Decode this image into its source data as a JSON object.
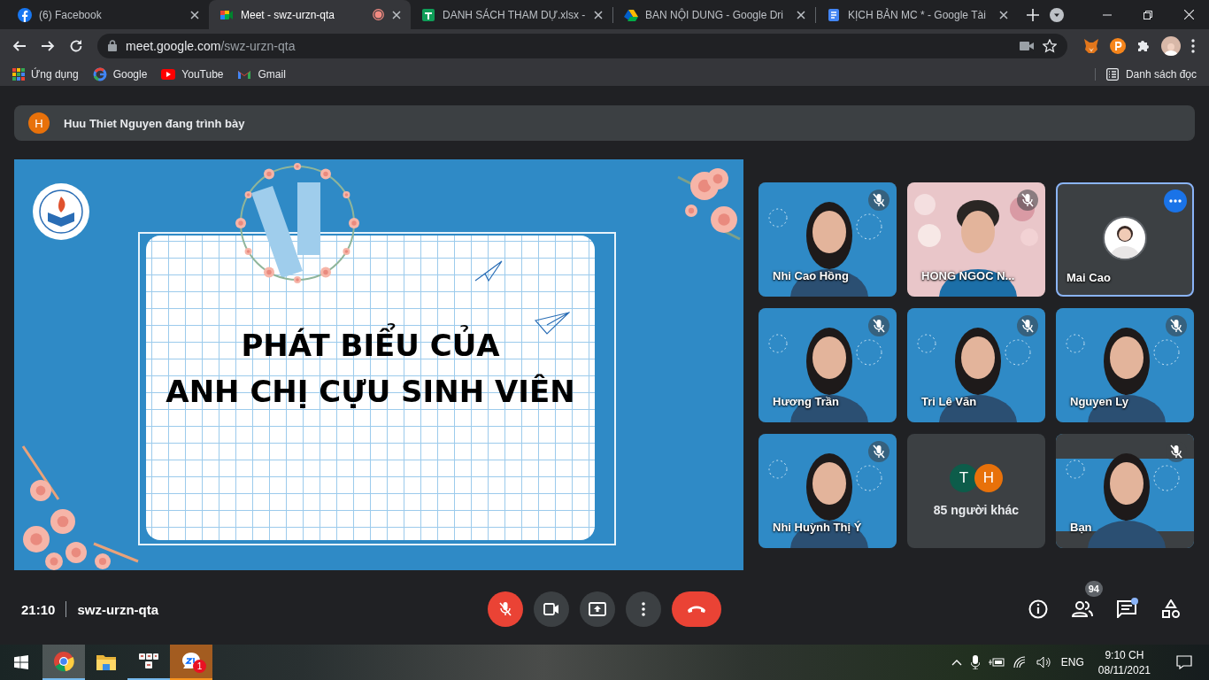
{
  "browser": {
    "tabs": [
      {
        "title": "(6) Facebook",
        "selected": false,
        "recording": false
      },
      {
        "title": "Meet - swz-urzn-qta",
        "selected": true,
        "recording": true
      },
      {
        "title": "DANH SÁCH THAM DỰ.xlsx -",
        "selected": false,
        "recording": false
      },
      {
        "title": "BAN NỘI DUNG - Google Dri",
        "selected": false,
        "recording": false
      },
      {
        "title": "KỊCH BẢN MC * - Google Tài",
        "selected": false,
        "recording": false
      }
    ],
    "address": {
      "host": "meet.google.com",
      "path": "/swz-urzn-qta"
    },
    "bookmarks": [
      {
        "label": "Ứng dụng"
      },
      {
        "label": "Google"
      },
      {
        "label": "YouTube"
      },
      {
        "label": "Gmail"
      }
    ],
    "reading_list": "Danh sách đọc"
  },
  "meet": {
    "presenter": {
      "initial": "H",
      "text": "Huu Thiet Nguyen đang trình bày"
    },
    "slide": {
      "lines": [
        "PHÁT BIỂU CỦA",
        "ANH CHỊ CỰU SINH VIÊN"
      ]
    },
    "tiles": [
      {
        "kind": "video",
        "name": "Nhi Cao Hồng",
        "muted": true,
        "focused": false
      },
      {
        "kind": "video",
        "name": "HONG NGOC N...",
        "muted": true,
        "focused": false
      },
      {
        "kind": "avatar",
        "name": "Mai Cao",
        "muted": false,
        "focused": true
      },
      {
        "kind": "video",
        "name": "Hương Trần",
        "muted": true,
        "focused": false
      },
      {
        "kind": "video",
        "name": "Tri Lê Văn",
        "muted": true,
        "focused": false
      },
      {
        "kind": "video",
        "name": "Nguyen Ly",
        "muted": true,
        "focused": false
      },
      {
        "kind": "video",
        "name": "Nhi Huỳnh Thị Ý",
        "muted": true,
        "focused": false
      },
      {
        "kind": "others",
        "label": "85 người khác",
        "avatars": [
          {
            "initial": "T",
            "color": "#0d5c4a"
          },
          {
            "initial": "H",
            "color": "#e8710a"
          }
        ]
      },
      {
        "kind": "video",
        "name": "Bạn",
        "muted": true,
        "focused": false
      }
    ],
    "meeting": {
      "time": "21:10",
      "code": "swz-urzn-qta",
      "mic_muted": true,
      "participant_count": "94",
      "chat_unread": true
    }
  },
  "taskbar": {
    "apps": [
      {
        "running": true,
        "focused": true,
        "flashing": false
      },
      {
        "running": false,
        "focused": false,
        "flashing": false
      },
      {
        "running": true,
        "focused": false,
        "flashing": false
      },
      {
        "running": true,
        "focused": false,
        "flashing": true,
        "badge": "1"
      }
    ],
    "tray": {
      "language": "ENG",
      "time": "9:10 CH",
      "date": "08/11/2021"
    }
  }
}
